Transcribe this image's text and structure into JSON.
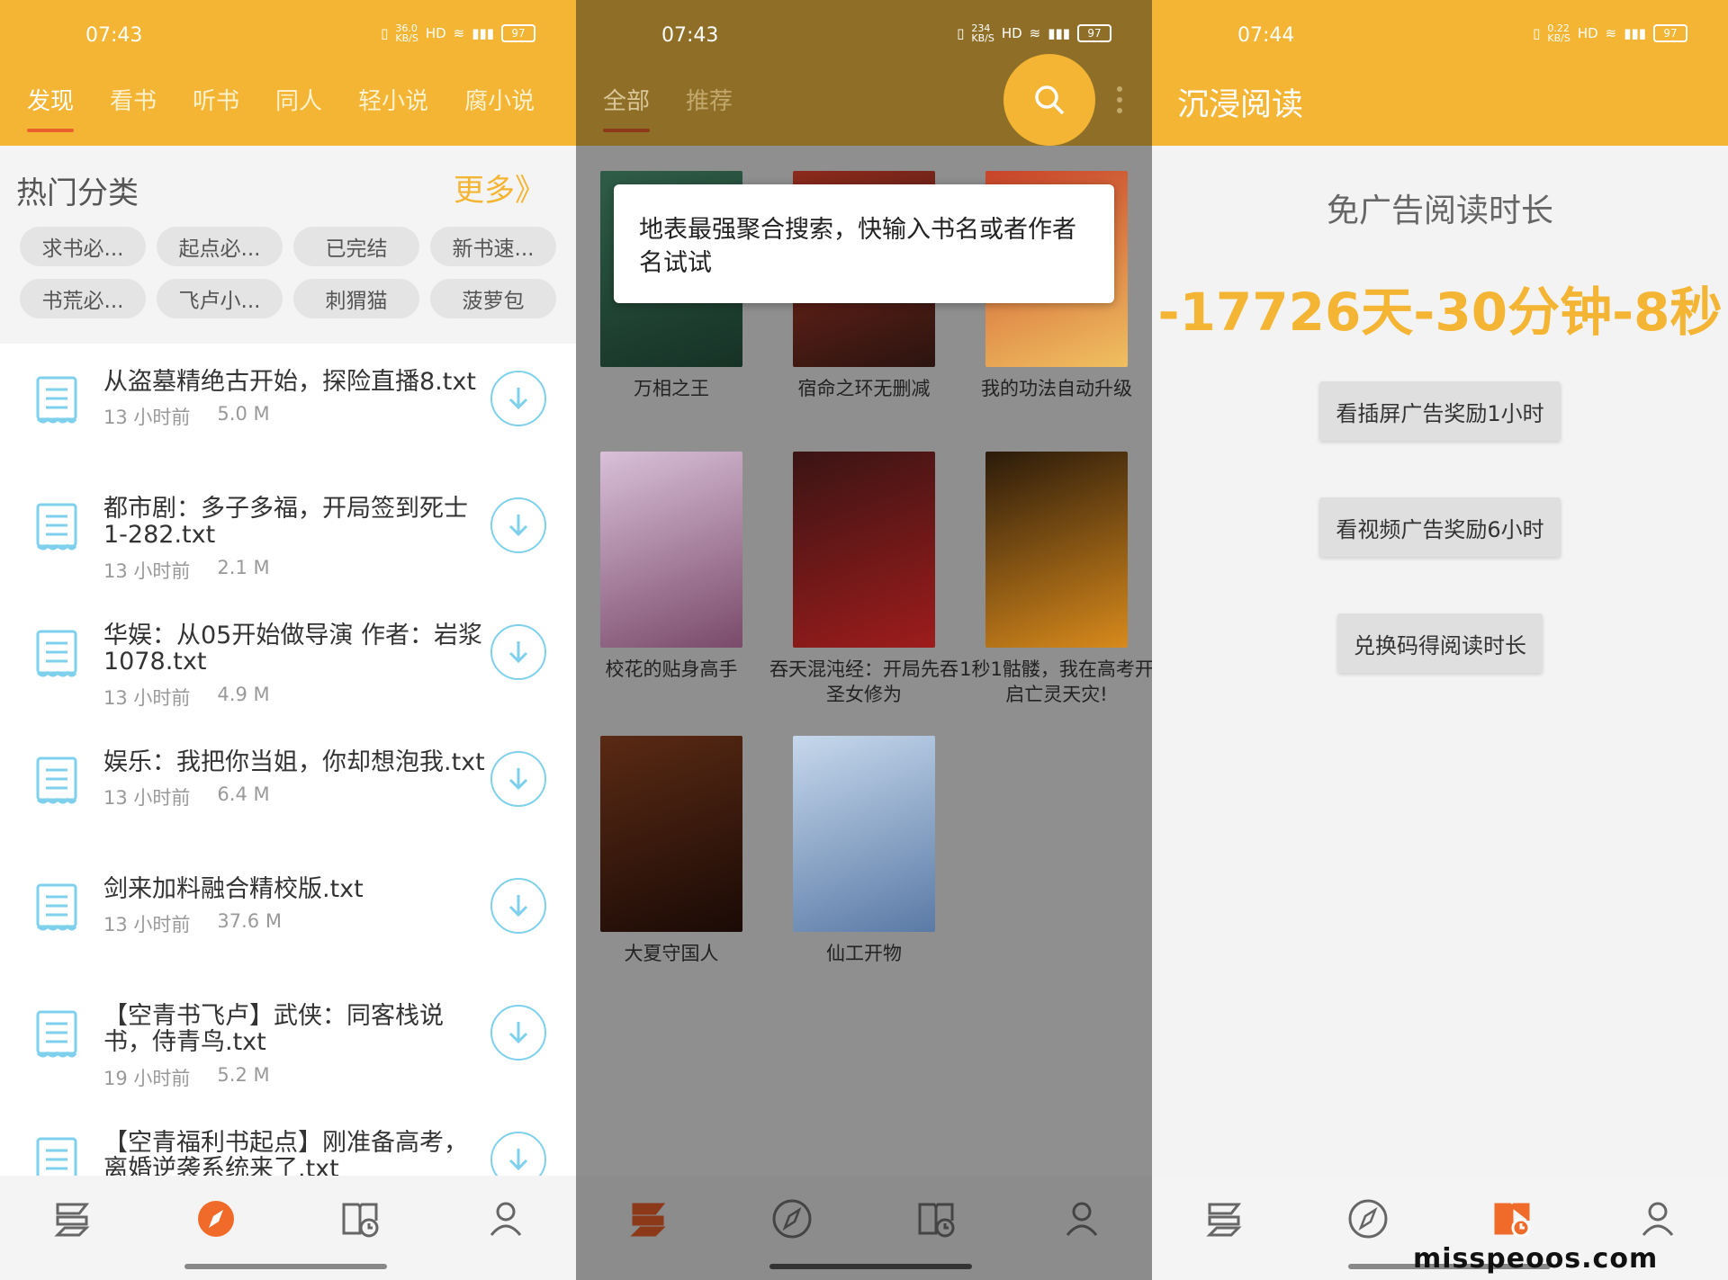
{
  "colors": {
    "accent": "#f3b533",
    "active_underline": "#e9612c",
    "download_ring": "#7fd0ec",
    "nav_active": "#f06b29"
  },
  "panel1": {
    "status": {
      "time": "07:43",
      "speed": "36.0\nKB/S",
      "battery": "97"
    },
    "tabs": [
      "发现",
      "看书",
      "听书",
      "同人",
      "轻小说",
      "腐小说"
    ],
    "section": {
      "title": "热门分类",
      "more": "更多》"
    },
    "chips": [
      "求书必...",
      "起点必...",
      "已完结",
      "新书速...",
      "书荒必...",
      "飞卢小...",
      "刺猬猫",
      "菠萝包"
    ],
    "files": [
      {
        "title": "从盗墓精绝古开始，探险直播8.txt",
        "time": "13 小时前",
        "size": "5.0 M"
      },
      {
        "title": "都市剧：多子多福，开局签到死士\n1-282.txt",
        "time": "13 小时前",
        "size": "2.1 M"
      },
      {
        "title": "华娱：从05开始做导演 作者：岩浆\n1078.txt",
        "time": "13 小时前",
        "size": "4.9 M"
      },
      {
        "title": "娱乐：我把你当姐，你却想泡我.txt",
        "time": "13 小时前",
        "size": "6.4 M"
      },
      {
        "title": "剑来加料融合精校版.txt",
        "time": "13 小时前",
        "size": "37.6 M"
      },
      {
        "title": "【空青书飞卢】武侠：同客栈说\n书，侍青鸟.txt",
        "time": "19 小时前",
        "size": "5.2 M"
      },
      {
        "title": "【空青福利书起点】刚准备高考，\n离婚逆袭系统来了.txt",
        "time": "",
        "size": ""
      }
    ],
    "nav_icons": [
      "bookshelf-icon",
      "compass-icon",
      "history-icon",
      "profile-icon"
    ]
  },
  "panel2": {
    "status": {
      "time": "07:43",
      "speed": "234\nKB/S",
      "battery": "97"
    },
    "tabs": [
      "全部",
      "推荐"
    ],
    "tooltip": "地表最强聚合搜索，快输入书名或者作者名试试",
    "books": [
      {
        "title": "万相之王",
        "cover": [
          "#2f5d48",
          "#163226"
        ]
      },
      {
        "title": "宿命之环无删减",
        "cover": [
          "#8c2a1c",
          "#2b1410"
        ]
      },
      {
        "title": "我的功法自动升级",
        "cover": [
          "#c8432a",
          "#f0c060"
        ]
      },
      {
        "title": "校花的贴身高手",
        "cover": [
          "#d9c0d8",
          "#7a4a6a"
        ]
      },
      {
        "title": "吞天混沌经：开局先吞圣女修为",
        "cover": [
          "#3a1414",
          "#9e1c1c"
        ]
      },
      {
        "title": "1秒1骷髅，我在高考开启亡灵天灾!",
        "cover": [
          "#2a1a0a",
          "#d88a1c"
        ]
      },
      {
        "title": "大夏守国人",
        "cover": [
          "#5a2a14",
          "#1a0a06"
        ]
      },
      {
        "title": "仙工开物",
        "cover": [
          "#c6d8ec",
          "#5a7aa6"
        ]
      }
    ]
  },
  "panel3": {
    "status": {
      "time": "07:44",
      "speed": "0.22\nKB/S",
      "battery": "97"
    },
    "app_title": "沉浸阅读",
    "ad_heading": "免广告阅读时长",
    "ad_time": "-17726天-30分钟-8秒",
    "buttons": [
      "看插屏广告奖励1小时",
      "看视频广告奖励6小时",
      "兑换码得阅读时长"
    ],
    "watermark": "misspeoos.com"
  }
}
